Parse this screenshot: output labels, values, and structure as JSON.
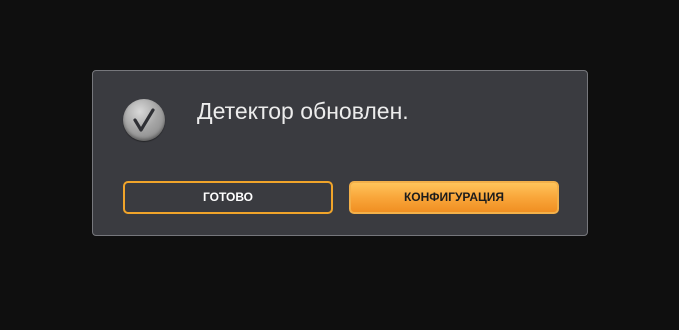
{
  "dialog": {
    "icon": "checkmark-circle-icon",
    "message": "Детектор обновлен.",
    "buttons": {
      "done_label": "ГОТОВО",
      "config_label": "КОНФИГУРАЦИЯ"
    }
  },
  "colors": {
    "background": "#0f0f0f",
    "dialog_background": "#3a3b40",
    "accent": "#f0a42a",
    "primary_button": "#f9a63a"
  }
}
